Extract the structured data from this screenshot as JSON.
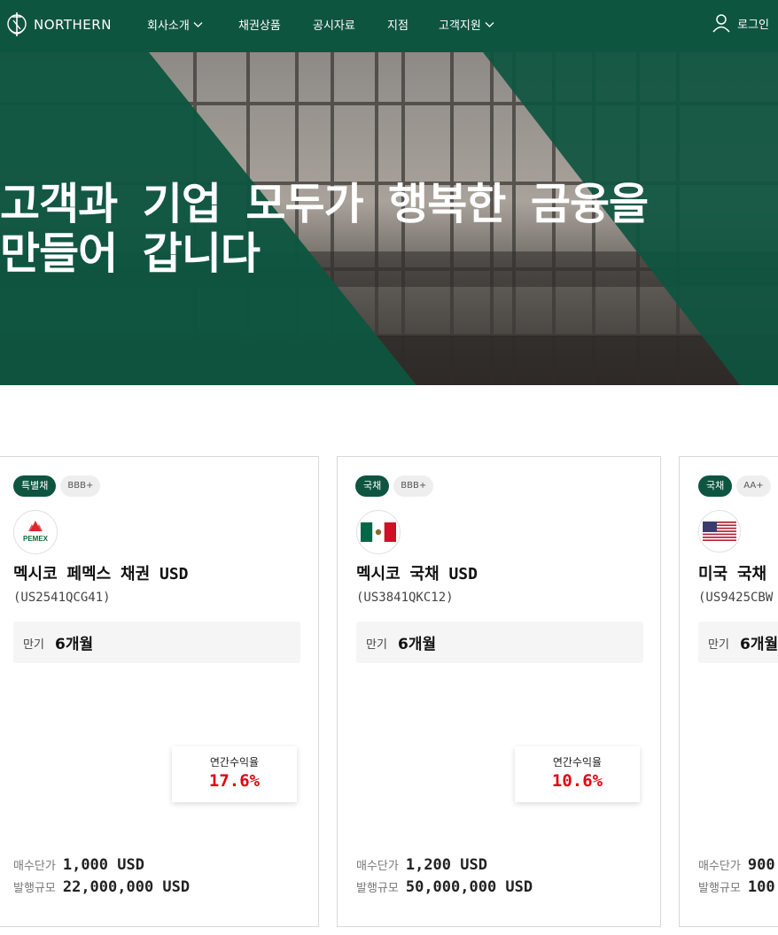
{
  "header": {
    "logo_text": "NORTHERN",
    "nav": [
      {
        "label": "회사소개",
        "has_dropdown": true
      },
      {
        "label": "채권상품",
        "has_dropdown": false
      },
      {
        "label": "공시자료",
        "has_dropdown": false
      },
      {
        "label": "지점",
        "has_dropdown": false
      },
      {
        "label": "고객지원",
        "has_dropdown": true
      }
    ],
    "login_label": "로그인"
  },
  "hero": {
    "title_line1": "고객과 기업 모두가 행복한 금융을",
    "title_line2": "만들어 갑니다"
  },
  "cards": [
    {
      "type_badge": "특별채",
      "rating": "BBB+",
      "logo": "pemex-logo",
      "logo_text": "PEMEX",
      "name": "멕시코 페멕스 채권 USD",
      "code": "(US2541QCG41)",
      "maturity_label": "만기",
      "maturity_value": "6개월",
      "yield_label": "연간수익율",
      "yield_value": "17.6%",
      "price_label": "매수단가",
      "price_value": "1,000 USD",
      "size_label": "발행규모",
      "size_value": "22,000,000 USD"
    },
    {
      "type_badge": "국채",
      "rating": "BBB+",
      "logo": "mexico-flag",
      "name": "멕시코 국채 USD",
      "code": "(US3841QKC12)",
      "maturity_label": "만기",
      "maturity_value": "6개월",
      "yield_label": "연간수익율",
      "yield_value": "10.6%",
      "price_label": "매수단가",
      "price_value": "1,200 USD",
      "size_label": "발행규모",
      "size_value": "50,000,000 USD"
    },
    {
      "type_badge": "국채",
      "rating": "AA+",
      "logo": "usa-flag",
      "name": "미국 국채",
      "code": "(US9425CBW",
      "maturity_label": "만기",
      "maturity_value": "6개월",
      "price_label": "매수단가",
      "price_value": "900",
      "size_label": "발행규모",
      "size_value": "100"
    }
  ],
  "colors": {
    "brand_green": "#0e5540",
    "yield_red": "#e3000f"
  }
}
